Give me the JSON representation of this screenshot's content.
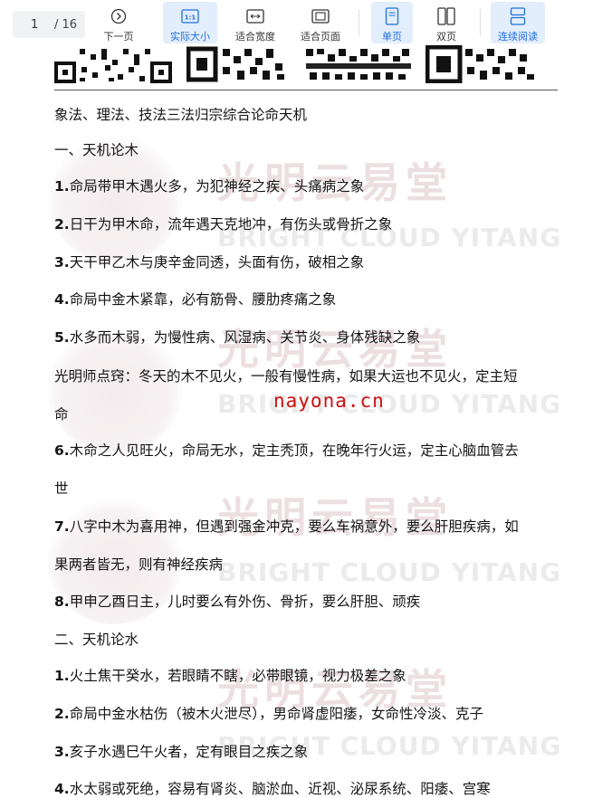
{
  "toolbar": {
    "page_current": "1",
    "page_total": "/ 16",
    "buttons": [
      {
        "label": "下一页",
        "icon": "next-page-icon"
      },
      {
        "label": "实际大小",
        "icon": "actual-size-icon"
      },
      {
        "label": "适合宽度",
        "icon": "fit-width-icon"
      },
      {
        "label": "适合页面",
        "icon": "fit-page-icon"
      },
      {
        "label": "单页",
        "icon": "single-page-icon"
      },
      {
        "label": "双页",
        "icon": "double-page-icon"
      },
      {
        "label": "连续阅读",
        "icon": "continuous-read-icon"
      }
    ],
    "accent_color": "#1f6fdb"
  },
  "document": {
    "title": "象法、理法、技法三法归宗综合论命天机",
    "watermark_cn": "光明云易堂",
    "watermark_en": "BRIGHT CLOUD YITANG",
    "site": "nayona.cn",
    "lines": [
      {
        "num": "",
        "text": "一、天机论木"
      },
      {
        "num": "1.",
        "text": "命局带甲木遇火多，为犯神经之疾、头痛病之象"
      },
      {
        "num": "2.",
        "text": "日干为甲木命，流年遇天克地冲，有伤头或骨折之象"
      },
      {
        "num": "3.",
        "text": "天干甲乙木与庚辛金同透，头面有伤，破相之象"
      },
      {
        "num": "4.",
        "text": "命局中金木紧靠，必有筋骨、腰肋疼痛之象"
      },
      {
        "num": "5.",
        "text": "水多而木弱，为慢性病、风湿病、关节炎、身体残缺之象"
      },
      {
        "num": "",
        "text": "光明师点窍：冬天的木不见火，一般有慢性病，如果大运也不见火，定主短"
      },
      {
        "num": "",
        "text": "命"
      },
      {
        "num": "6.",
        "text": "木命之人见旺火，命局无水，定主秃顶，在晚年行火运，定主心脑血管去"
      },
      {
        "num": "",
        "text": "世"
      },
      {
        "num": "7.",
        "text": "八字中木为喜用神，但遇到强金冲克，要么车祸意外，要么肝胆疾病，如"
      },
      {
        "num": "",
        "text": "果两者皆无，则有神经疾病"
      },
      {
        "num": "8.",
        "text": "甲申乙酉日主，儿时要么有外伤、骨折，要么肝胆、顽疾"
      },
      {
        "num": "",
        "text": "二、天机论水"
      },
      {
        "num": "1.",
        "text": "火土焦干癸水，若眼睛不瞎，必带眼镜，视力极差之象"
      },
      {
        "num": "2.",
        "text": "命局中金水枯伤（被木火泄尽），男命肾虚阳痿，女命性冷淡、克子"
      },
      {
        "num": "3.",
        "text": "亥子水遇巳午火者，定有眼目之疾之象"
      },
      {
        "num": "4.",
        "text": "水太弱或死绝，容易有肾炎、脑淤血、近视、泌尿系统、阳痿、宫寒"
      }
    ]
  }
}
